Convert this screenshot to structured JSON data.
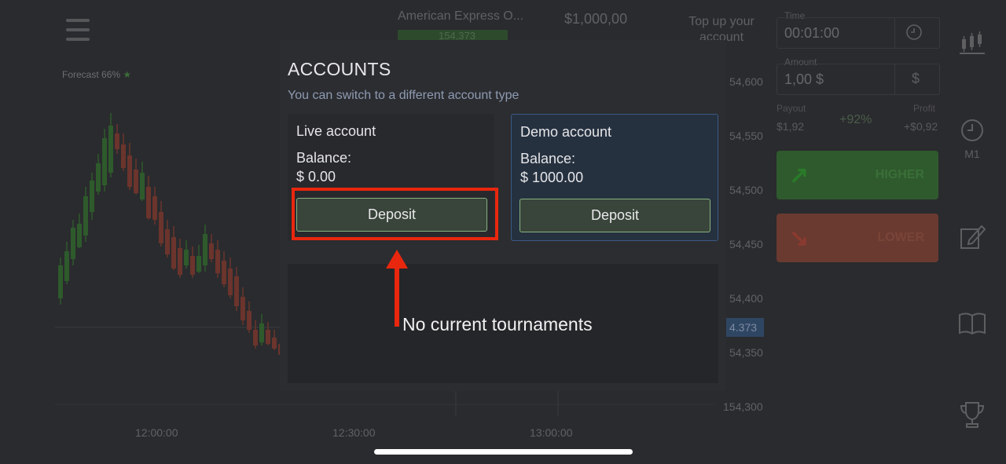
{
  "app": {
    "asset_name": "American Express O...",
    "asset_change": "154,373",
    "balance": "$1,000,00",
    "balance_mode": "Demo",
    "topup_label": "Top up your account",
    "forecast": "Forecast 66%"
  },
  "chart": {
    "time_labels": [
      "12:00:00",
      "12:30:00",
      "13:00:00"
    ],
    "price_labels": [
      "54,600",
      "54,550",
      "54,500",
      "54,450",
      "54,400",
      "54,350",
      "154,300"
    ],
    "current_price": "4.373"
  },
  "trade_panel": {
    "time_label": "Time",
    "time_value": "00:01:00",
    "amount_label": "Amount",
    "amount_value": "1,00 $",
    "currency_symbol": "$",
    "payout_label": "Payout",
    "payout_value": "$1,92",
    "payout_percent": "+92%",
    "profit_label": "Profit",
    "profit_value": "+$0,92",
    "higher_label": "HIGHER",
    "lower_label": "LOWER"
  },
  "sidebar": {
    "timeframe_label": "M1"
  },
  "modal": {
    "title": "ACCOUNTS",
    "subtitle": "You can switch to a different account type",
    "accounts": [
      {
        "name": "Live account",
        "balance_label": "Balance:",
        "balance_value": "$ 0.00",
        "button_label": "Deposit"
      },
      {
        "name": "Demo account",
        "balance_label": "Balance:",
        "balance_value": "$ 1000.00",
        "button_label": "Deposit"
      }
    ],
    "tournaments_text": "No current tournaments"
  },
  "colors": {
    "highlight": "#e8270e",
    "demo_border": "#3a5a85",
    "deposit_border": "#86b27e",
    "up_candle": "#2e5a2c",
    "down_candle": "#6b342c"
  },
  "icons": [
    "menu-icon",
    "clock-icon",
    "dollar-icon",
    "candlestick-icon",
    "timeframe-clock-icon",
    "edit-icon",
    "book-icon",
    "trophy-icon",
    "arrow-up-icon"
  ]
}
